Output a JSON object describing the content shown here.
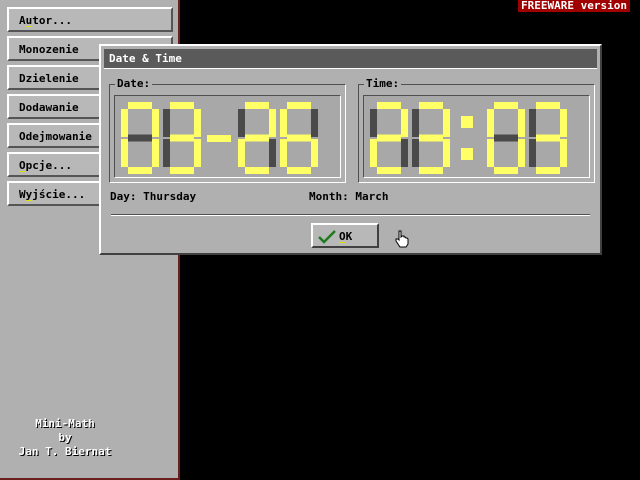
{
  "sidebar": {
    "menu": [
      {
        "pre": "A",
        "hot": "u",
        "post": "tor..."
      },
      {
        "pre": "Monozenie",
        "hot": "",
        "post": ""
      },
      {
        "pre": "Dzielenie",
        "hot": "",
        "post": ""
      },
      {
        "pre": "Dodawanie",
        "hot": "",
        "post": ""
      },
      {
        "pre": "Odejmowanie",
        "hot": "",
        "post": ""
      },
      {
        "pre": "",
        "hot": "O",
        "post": "pcje..."
      },
      {
        "pre": "W",
        "hot": "y",
        "post": "jście..."
      }
    ],
    "credits": {
      "line1": "Mini-Math",
      "line2": "by",
      "line3": "Jan T. Biernat"
    }
  },
  "badge": "FREEWARE version",
  "dialog": {
    "title": "Date & Time",
    "date": {
      "label": "Date:",
      "month": "03",
      "day": "26"
    },
    "time": {
      "label": "Time:",
      "hours": "23",
      "minutes": "03"
    },
    "day_label": "Day:",
    "day_value": "Thursday",
    "month_label": "Month:",
    "month_value": "March",
    "ok": {
      "hot": "O",
      "rest": "K"
    }
  },
  "colors": {
    "lcd_on": "#ffff66",
    "lcd_off": "#4a4a4a",
    "lcd_background": "#a8a8a8",
    "badge_background": "#a00000"
  },
  "icons": {
    "ok": "checkmark-icon",
    "cursor": "hand-pointer-icon"
  }
}
